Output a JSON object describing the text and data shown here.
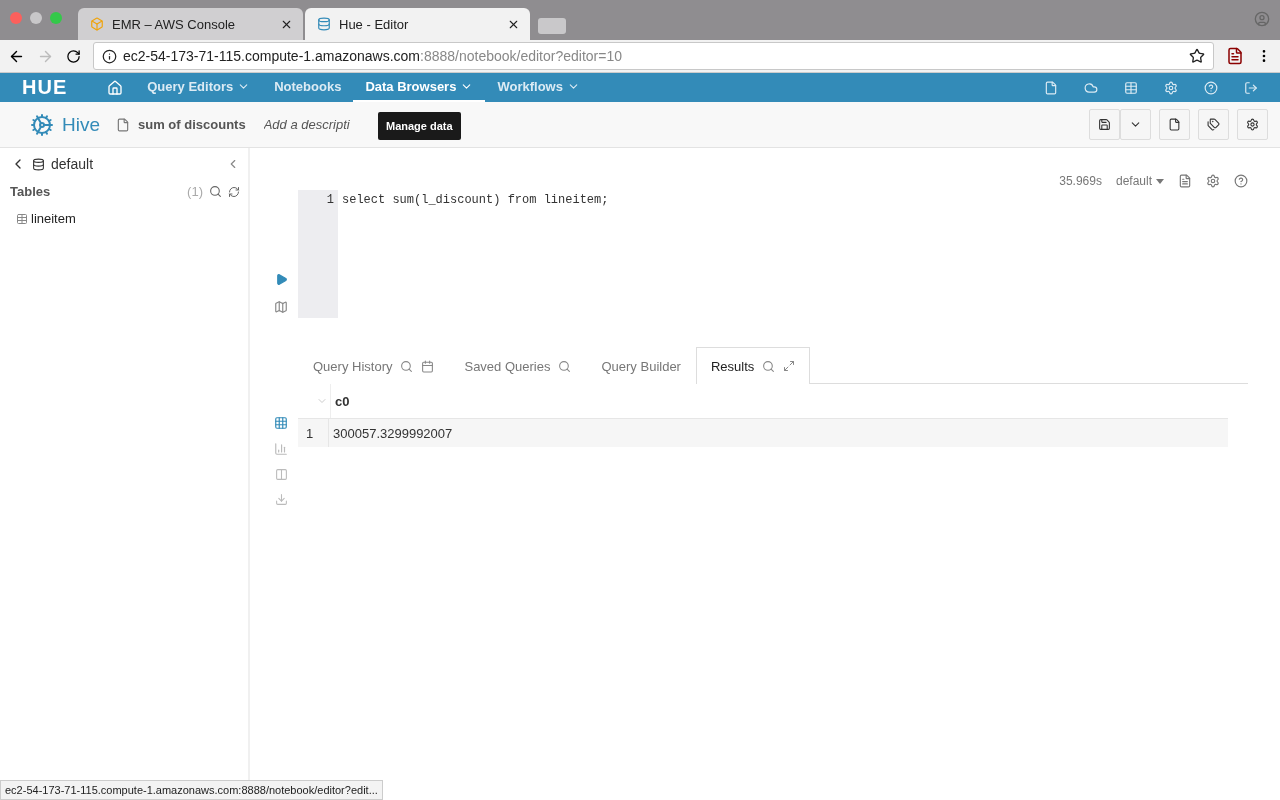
{
  "browser": {
    "tabs": [
      {
        "title": "EMR – AWS Console",
        "selected": false
      },
      {
        "title": "Hue - Editor",
        "selected": true
      }
    ],
    "url_host": "ec2-54-173-71-115.compute-1.amazonaws.com",
    "url_rest": ":8888/notebook/editor?editor=10"
  },
  "nav": {
    "logo": "HUE",
    "items": [
      {
        "label": "Query Editors",
        "dropdown": true,
        "selected": false
      },
      {
        "label": "Notebooks",
        "dropdown": false,
        "selected": false
      },
      {
        "label": "Data Browsers",
        "dropdown": true,
        "selected": true
      },
      {
        "label": "Workflows",
        "dropdown": true,
        "selected": false
      }
    ],
    "tooltip": "Manage data"
  },
  "toolbar": {
    "app": "Hive",
    "query_name": "sum of discounts",
    "description_placeholder": "Add a descripti"
  },
  "sidebar": {
    "database": "default",
    "section": "Tables",
    "count": "(1)",
    "tables": [
      "lineitem"
    ]
  },
  "editor": {
    "elapsed": "35.969s",
    "database": "default",
    "lines": [
      {
        "number": "1",
        "code": "select sum(l_discount) from lineitem;"
      }
    ]
  },
  "result_tabs": [
    {
      "label": "Query History",
      "selected": false
    },
    {
      "label": "Saved Queries",
      "selected": false
    },
    {
      "label": "Query Builder",
      "selected": false
    },
    {
      "label": "Results",
      "selected": true
    }
  ],
  "results": {
    "columns": [
      "c0"
    ],
    "rows": [
      {
        "index": "1",
        "cells": [
          "300057.3299992007"
        ]
      }
    ]
  },
  "status_url": "ec2-54-173-71-115.compute-1.amazonaws.com:8888/notebook/editor?edit..."
}
